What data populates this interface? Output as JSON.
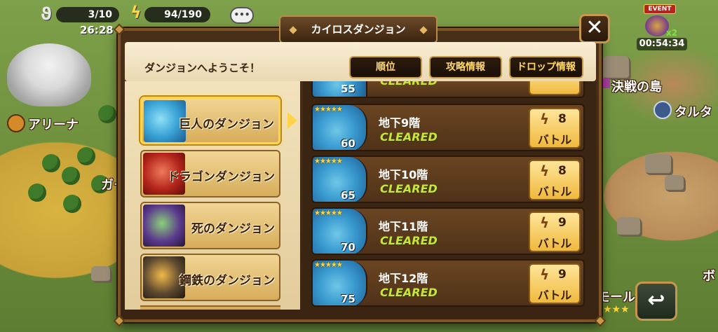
{
  "hud": {
    "wing_count": "3/10",
    "energy_count": "94/190",
    "timer": "26:28",
    "chat_text": "•••"
  },
  "event": {
    "badge": "EVENT",
    "multiplier": "x2",
    "timer": "00:54:34"
  },
  "map_labels": {
    "arena": "アリーナ",
    "left_partial": "ガー",
    "battle_island": "決戦の島",
    "right_partial": "タルタ",
    "bottom_right_partial": "ボ",
    "mall_partial": "モール"
  },
  "dialog": {
    "title": "カイロスダンジョン",
    "welcome": "ダンジョンへようこそ！",
    "buttons": {
      "ranking": "順位",
      "strategy": "攻略情報",
      "drops": "ドロップ情報"
    },
    "close_label": "✕"
  },
  "dungeons": [
    {
      "label": "巨人のダンジョン",
      "active": true
    },
    {
      "label": "ドラゴンダンジョン",
      "active": false
    },
    {
      "label": "死のダンジョン",
      "active": false
    },
    {
      "label": "鋼鉄のダンジョン",
      "active": false
    }
  ],
  "partial_floor": {
    "level": "55",
    "status": "CLEARED"
  },
  "floors": [
    {
      "name": "地下9階",
      "stars": "★★★★★",
      "level": "60",
      "status": "CLEARED",
      "cost": "8",
      "battle": "バトル"
    },
    {
      "name": "地下10階",
      "stars": "★★★★★",
      "level": "65",
      "status": "CLEARED",
      "cost": "8",
      "battle": "バトル"
    },
    {
      "name": "地下11階",
      "stars": "★★★★★",
      "level": "70",
      "status": "CLEARED",
      "cost": "9",
      "battle": "バトル"
    },
    {
      "name": "地下12階",
      "stars": "★★★★★",
      "level": "75",
      "status": "CLEARED",
      "cost": "9",
      "battle": "バトル"
    }
  ],
  "colors": {
    "accent_gold": "#ffd34a",
    "cleared_green": "#c9e53a",
    "dialog_brown": "#3b2412"
  }
}
